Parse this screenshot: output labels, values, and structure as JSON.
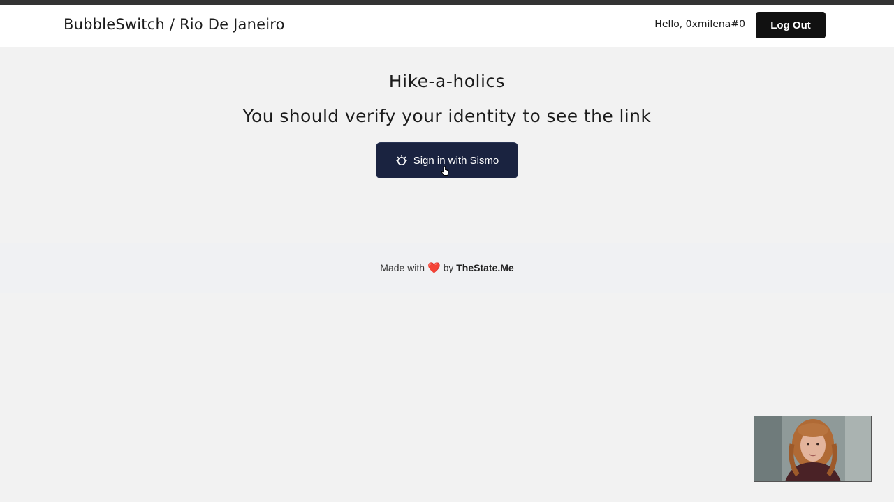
{
  "header": {
    "brand": "BubbleSwitch / Rio De Janeiro",
    "greeting": "Hello, 0xmilena#0",
    "logout_label": "Log Out"
  },
  "main": {
    "group_title": "Hike-a-holics",
    "verify_message": "You should verify your identity to see the link",
    "sismo_button_label": "Sign in with Sismo"
  },
  "footer": {
    "made_with": "Made with",
    "heart": "❤️",
    "by": "by",
    "brand": "TheState.Me"
  },
  "colors": {
    "page_bg": "#f2f2f2",
    "header_bg": "#ffffff",
    "logout_bg": "#111111",
    "sismo_bg": "#1a2340",
    "heart": "#e02424"
  },
  "icons": {
    "sismo": "sismo-logo-icon",
    "cursor": "hand-pointer-cursor-icon"
  }
}
